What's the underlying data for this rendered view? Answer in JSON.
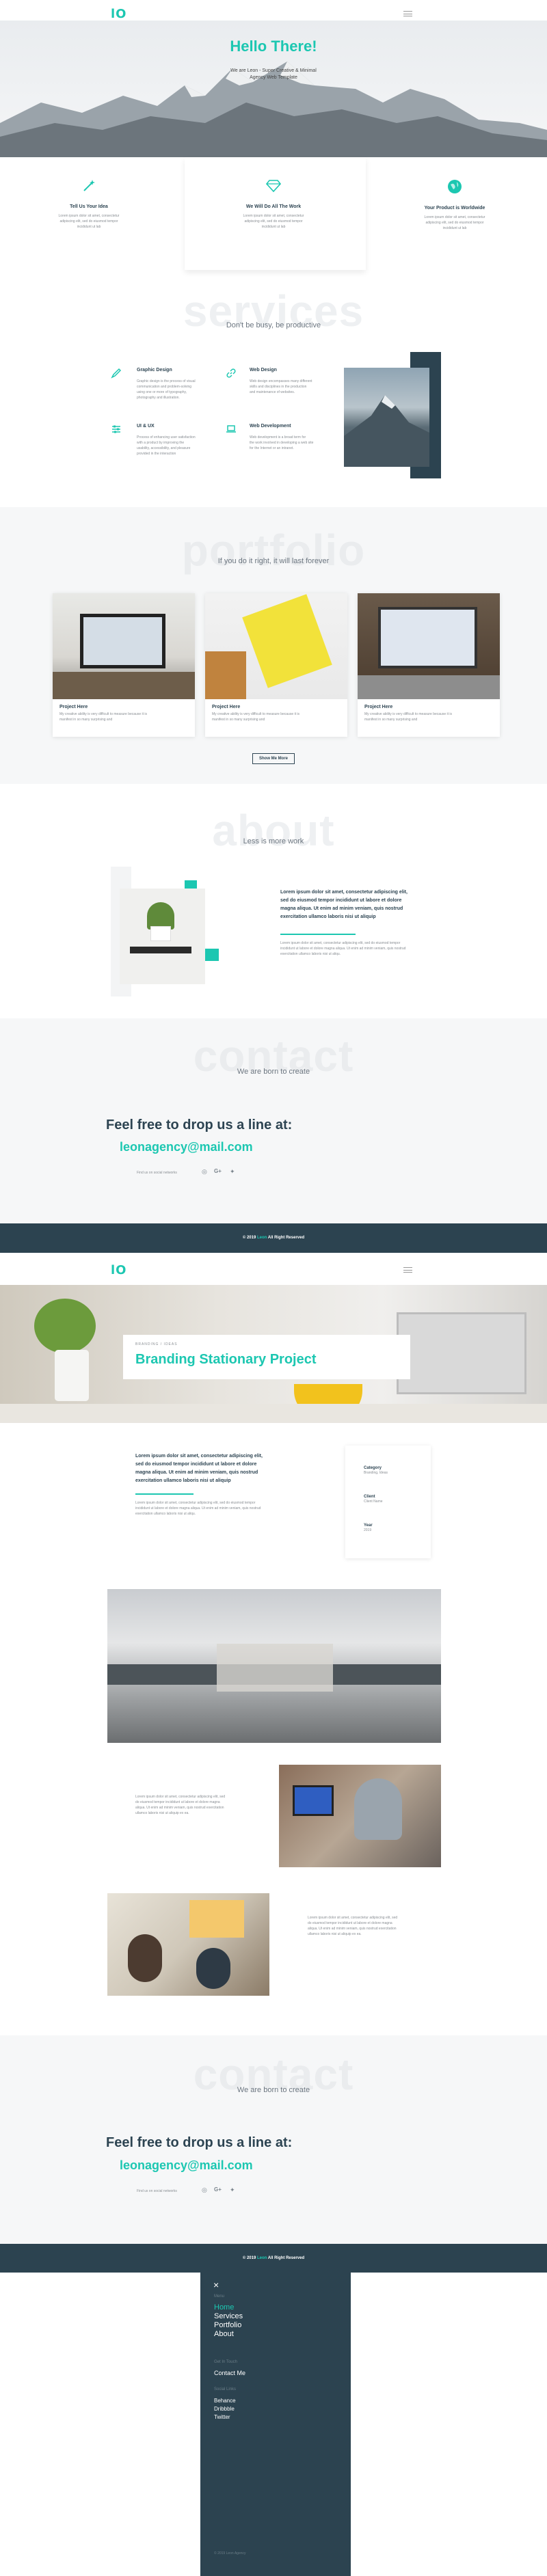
{
  "page1": {
    "logo": "lO",
    "hero": {
      "title": "Hello There!",
      "subtitle_line1": "We are Leon - Super Creative & Minimal",
      "subtitle_line2": "Agency Web Template"
    },
    "features": [
      {
        "title": "Tell Us Your Idea",
        "text1": "Lorem ipsum dolor sit amet, consectetur",
        "text2": "adipiscing elit, sed do eiusmod tempor",
        "text3": "incididunt ut lab",
        "icon": "magic-wand-icon"
      },
      {
        "title": "We Will Do All The Work",
        "text1": "Lorem ipsum dolor sit amet, consectetur",
        "text2": "adipiscing elit, sed do eiusmod tempor",
        "text3": "incididunt ut lab",
        "icon": "diamond-icon"
      },
      {
        "title": "Your Product is Worldwide",
        "text1": "Lorem ipsum dolor sit amet, consectetur",
        "text2": "adipiscing elit, sed do eiusmod tempor",
        "text3": "incididunt ut lab",
        "icon": "globe-icon"
      }
    ],
    "services": {
      "bigword": "services",
      "tagline": "Don't be busy, be productive",
      "items": [
        {
          "title": "Graphic Design",
          "icon": "pen-icon",
          "text1": "Graphic design is the process of visual",
          "text2": "communication and problem-solving",
          "text3": "using one or more of typography,",
          "text4": "photography and illustration."
        },
        {
          "title": "Web Design",
          "icon": "link-icon",
          "text1": "Web design encompasses many different",
          "text2": "skills and disciplines in the production",
          "text3": "and maintenance of websites.",
          "text4": ""
        },
        {
          "title": "UI & UX",
          "icon": "sliders-icon",
          "text1": "Process of enhancing user satisfaction",
          "text2": "with a product by improving the",
          "text3": "usability, accessibility, and pleasure",
          "text4": "provided in the interaction"
        },
        {
          "title": "Web Development",
          "icon": "laptop-icon",
          "text1": "Web development is a broad term for",
          "text2": "the work involved in developing a web site",
          "text3": "for the Internet or an intranet.",
          "text4": ""
        }
      ]
    },
    "portfolio": {
      "bigword": "portfolio",
      "tagline": "If you do it right, it will last forever",
      "projects": [
        {
          "title": "Project Here",
          "text1": "My creative ability is very difficult to measure because it is",
          "text2": "manifest in so many surprising and"
        },
        {
          "title": "Project Here",
          "text1": "My creative ability is very difficult to measure because it is",
          "text2": "manifest in so many surprising and"
        },
        {
          "title": "Project Here",
          "text1": "My creative ability is very difficult to measure because it is",
          "text2": "manifest in so many surprising and"
        }
      ],
      "button": "Show Me More"
    },
    "about": {
      "bigword": "about",
      "tagline": "Less is more work",
      "bold1": "Lorem ipsum dolor sit amet, consectetur adipiscing elit,",
      "bold2": "sed do eiusmod tempor incididunt ut labore et dolore",
      "bold3": "magna aliqua. Ut enim ad minim veniam, quis nostrud",
      "bold4": "exercitation ullamco laboris nisi ut aliquip",
      "p1": "Lorem ipsum dolor sit amet, consectetur adipiscing elit, sed do eiusmod tempor",
      "p2": "incididunt ut labore et dolore magna aliqua. Ut enim ad minim veniam, quis nostrud",
      "p3": "exercitation ullamco laboris nisi ut aliqu."
    },
    "contact": {
      "bigword": "contact",
      "tagline": "We are born to create",
      "headline": "Feel free to drop us a line at:",
      "email": "leonagency@mail.com",
      "social_label": "Find us on social networks",
      "social": [
        "instagram-icon",
        "google-plus-icon",
        "twitter-icon"
      ]
    },
    "footer": {
      "prefix": "© 2019",
      "brand": "Leon",
      "suffix": "All Right Reserved"
    }
  },
  "page2": {
    "logo": "lO",
    "hero": {
      "category": "BRANDING / IDEAS",
      "title": "Branding Stationary Project"
    },
    "intro": {
      "bold1": "Lorem ipsum dolor sit amet, consectetur adipiscing elit,",
      "bold2": "sed do eiusmod tempor incididunt ut labore et dolore",
      "bold3": "magna aliqua. Ut enim ad minim veniam, quis nostrud",
      "bold4": "exercitation ullamco laboris nisi ut aliquip",
      "p1": "Lorem ipsum dolor sit amet, consectetur adipiscing elit, sed do eiusmod tempor",
      "p2": "incididunt ut labore et dolore magna aliqua. Ut enim ad minim veniam, quis nostrud",
      "p3": "exercitation ullamco laboris nisi ut aliqu."
    },
    "meta": [
      {
        "label": "Category",
        "value": "Branding, Ideas"
      },
      {
        "label": "Client",
        "value": "Client Name"
      },
      {
        "label": "Year",
        "value": "2019"
      }
    ],
    "block1": {
      "p1": "Lorem ipsum dolor sit amet, consectetur adipiscing elit, sed",
      "p2": "do eiusmod tempor incididunt ut labore et dolore magna",
      "p3": "aliqua. Ut enim ad minim veniam, quis nostrud exercitation",
      "p4": "ullamco laboris nisi ut aliquip ex ea."
    },
    "block2": {
      "p1": "Lorem ipsum dolor sit amet, consectetur adipiscing elit, sed",
      "p2": "do eiusmod tempor incididunt ut labore et dolore magna",
      "p3": "aliqua. Ut enim ad minim veniam, quis nostrud exercitation",
      "p4": "ullamco laboris nisi ut aliquip ex ea."
    },
    "contact": {
      "bigword": "contact",
      "tagline": "We are born to create",
      "headline": "Feel free to drop us a line at:",
      "email": "leonagency@mail.com",
      "social_label": "Find us on social networks"
    },
    "footer": {
      "prefix": "© 2019",
      "brand": "Leon",
      "suffix": "All Right Reserved"
    }
  },
  "menu": {
    "close": "×",
    "section1_label": "Menu",
    "items": [
      "Home",
      "Services",
      "Portfolio",
      "About"
    ],
    "section2_label": "Get In Touch",
    "contact": "Contact Me",
    "section3_label": "Social Links",
    "social": [
      "Behance",
      "Dribbble",
      "Twitter"
    ],
    "copyright": "© 2019 Leon Agency"
  },
  "colors": {
    "accent": "#1cc7b1",
    "dark": "#2c4350",
    "text": "#2d4452"
  }
}
